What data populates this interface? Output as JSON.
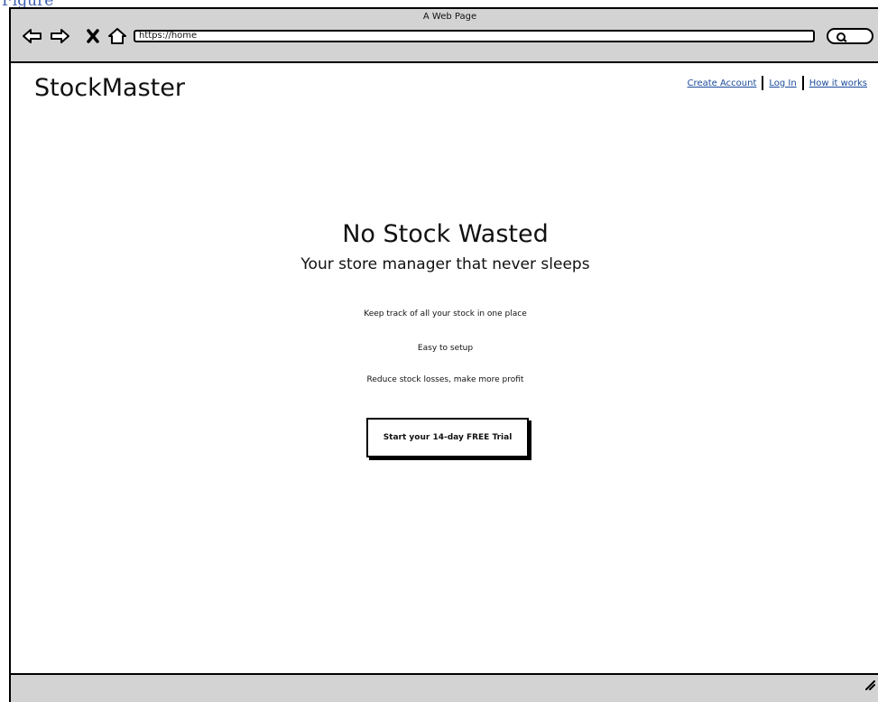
{
  "figure_caption": "Figure",
  "window": {
    "title": "A Web Page"
  },
  "browser": {
    "url": "https://home",
    "icons": [
      "back-arrow-icon",
      "forward-arrow-icon",
      "close-icon",
      "home-icon",
      "search-icon"
    ]
  },
  "header": {
    "brand": "StockMaster",
    "links": [
      "Create Account",
      "Log In",
      "How it works"
    ]
  },
  "hero": {
    "title": "No Stock Wasted",
    "subtitle": "Your store manager that never sleeps"
  },
  "features": [
    "Keep track of all your stock in one place",
    "Easy to setup",
    "Reduce stock losses, make more profit"
  ],
  "cta": {
    "label": "Start your 14-day FREE Trial"
  },
  "colors": {
    "chrome": "#d3d3d3",
    "link": "#1a4a9a",
    "caption": "#3b5fb0"
  }
}
